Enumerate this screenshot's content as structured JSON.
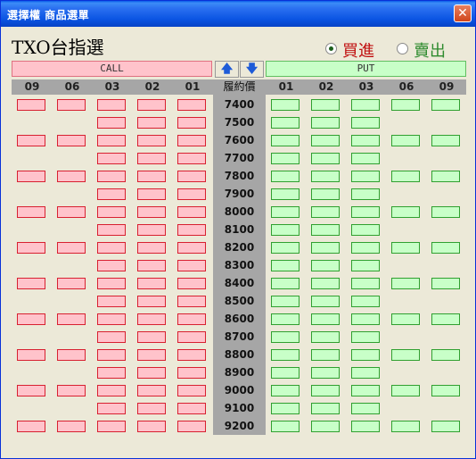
{
  "window": {
    "title": "選擇權 商品選單",
    "close_label": "✕"
  },
  "product": {
    "heading": "TXO台指選"
  },
  "direction": {
    "buy_label": "買進",
    "sell_label": "賣出",
    "selected": "buy"
  },
  "sections": {
    "call_label": "CALL",
    "put_label": "PUT"
  },
  "nav": {
    "up_icon": "🡅",
    "down_icon": "🡇"
  },
  "colors": {
    "call_fill": "#ffc3cb",
    "call_border": "#d82030",
    "put_fill": "#c8ffc8",
    "put_border": "#30a030",
    "strike_bg": "#a6a6a6",
    "titlebar": "#0b55e3"
  },
  "columns": {
    "call": [
      "09",
      "06",
      "03",
      "02",
      "01"
    ],
    "put": [
      "01",
      "02",
      "03",
      "06",
      "09"
    ],
    "strike_header": "履約價"
  },
  "strikes": [
    "7400",
    "7500",
    "7600",
    "7700",
    "7800",
    "7900",
    "8000",
    "8100",
    "8200",
    "8300",
    "8400",
    "8500",
    "8600",
    "8700",
    "8800",
    "8900",
    "9000",
    "9100",
    "9200"
  ]
}
